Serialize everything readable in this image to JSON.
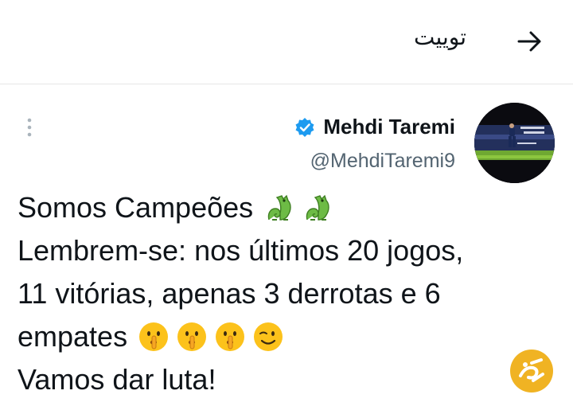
{
  "header": {
    "title": "توییت",
    "back_icon": "arrow-right-icon"
  },
  "tweet": {
    "author": {
      "name": "Mehdi Taremi",
      "handle": "@MehdiTaremi9",
      "verified": true,
      "verified_color": "#1d9bf0"
    },
    "lines": [
      "Somos Campeões",
      "Lembrem-se: nos últimos 20 jogos,",
      "11 vitórias, apenas 3 derrotas e 6",
      "empates",
      "Vamos dar luta!"
    ],
    "emojis": {
      "line1": [
        "dragon-emoji",
        "dragon-emoji"
      ],
      "line4": [
        "shushing-face-emoji",
        "shushing-face-emoji",
        "shushing-face-emoji",
        "winking-face-emoji"
      ]
    },
    "more_icon": "more-vertical-icon"
  },
  "colors": {
    "text": "#0f1419",
    "secondary_text": "#536471",
    "divider": "#e6e6e6",
    "watermark": "#f0b323"
  }
}
